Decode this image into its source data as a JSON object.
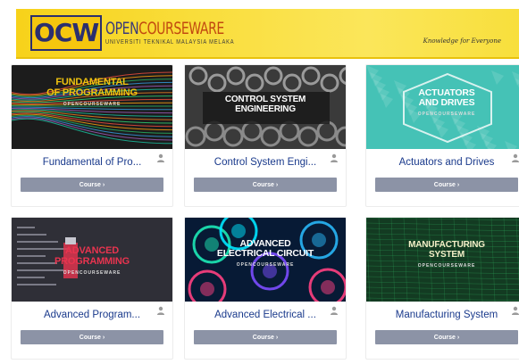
{
  "banner": {
    "logo_mark": "OCW",
    "logo_main_open": "OPEN",
    "logo_main_rest": "COURSEWARE",
    "logo_sub": "UNIVERSITI TEKNIKAL MALAYSIA MELAKA",
    "tagline": "Knowledge for Everyone"
  },
  "courses": [
    {
      "thumb_title": "FUNDAMENTAL\nOF PROGRAMMING",
      "thumb_sub": "OPENCOURSEWARE",
      "title": "Fundamental of Pro...",
      "button": "Course ›",
      "theme": "fundamental"
    },
    {
      "thumb_title": "CONTROL SYSTEM\nENGINEERING",
      "thumb_sub": "",
      "title": "Control System Engi...",
      "button": "Course ›",
      "theme": "control"
    },
    {
      "thumb_title": "ACTUATORS\nAND DRIVES",
      "thumb_sub": "OPENCOURSEWARE",
      "title": "Actuators and Drives",
      "button": "Course ›",
      "theme": "actuators"
    },
    {
      "thumb_title": "ADVANCED\nPROGRAMMING",
      "thumb_sub": "OPENCOURSEWARE",
      "title": "Advanced Program...",
      "button": "Course ›",
      "theme": "advprog"
    },
    {
      "thumb_title": "ADVANCED\nELECTRICAL CIRCUIT",
      "thumb_sub": "OPENCOURSEWARE",
      "title": "Advanced Electrical ...",
      "button": "Course ›",
      "theme": "electrical"
    },
    {
      "thumb_title": "MANUFACTURING\nSYSTEM",
      "thumb_sub": "OPENCOURSEWARE",
      "title": "Manufacturing System",
      "button": "Course ›",
      "theme": "manufacturing"
    }
  ],
  "icons": {
    "enrol": "user-icon",
    "course_button_arrow": "chevron-right-icon"
  }
}
